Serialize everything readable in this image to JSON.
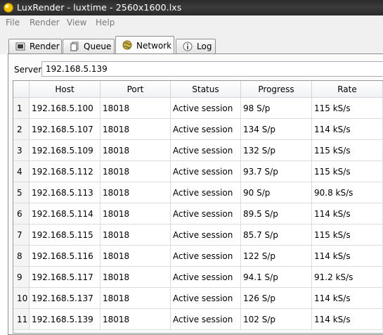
{
  "window": {
    "title": "LuxRender - luxtime - 2560x1600.lxs"
  },
  "menu": [
    "File",
    "Render",
    "View",
    "Help"
  ],
  "tabs": [
    {
      "label": "Render",
      "icon": "render-icon",
      "active": false
    },
    {
      "label": "Queue",
      "icon": "queue-icon",
      "active": false
    },
    {
      "label": "Network",
      "icon": "network-globe-icon",
      "active": true
    },
    {
      "label": "Log",
      "icon": "info-icon",
      "active": false
    }
  ],
  "server": {
    "label": "Server:",
    "value": "192.168.5.139"
  },
  "table": {
    "columns": [
      "Host",
      "Port",
      "Status",
      "Progress",
      "Rate"
    ],
    "rows": [
      {
        "n": "1",
        "host": "192.168.5.100",
        "port": "18018",
        "status": "Active session",
        "progress": "98 S/p",
        "rate": "115 kS/s"
      },
      {
        "n": "2",
        "host": "192.168.5.107",
        "port": "18018",
        "status": "Active session",
        "progress": "134 S/p",
        "rate": "114 kS/s"
      },
      {
        "n": "3",
        "host": "192.168.5.109",
        "port": "18018",
        "status": "Active session",
        "progress": "132 S/p",
        "rate": "115 kS/s"
      },
      {
        "n": "4",
        "host": "192.168.5.112",
        "port": "18018",
        "status": "Active session",
        "progress": "93.7 S/p",
        "rate": "115 kS/s"
      },
      {
        "n": "5",
        "host": "192.168.5.113",
        "port": "18018",
        "status": "Active session",
        "progress": "90 S/p",
        "rate": "90.8 kS/s"
      },
      {
        "n": "6",
        "host": "192.168.5.114",
        "port": "18018",
        "status": "Active session",
        "progress": "89.5 S/p",
        "rate": "114 kS/s"
      },
      {
        "n": "7",
        "host": "192.168.5.115",
        "port": "18018",
        "status": "Active session",
        "progress": "85.7 S/p",
        "rate": "115 kS/s"
      },
      {
        "n": "8",
        "host": "192.168.5.116",
        "port": "18018",
        "status": "Active session",
        "progress": "122 S/p",
        "rate": "114 kS/s"
      },
      {
        "n": "9",
        "host": "192.168.5.117",
        "port": "18018",
        "status": "Active session",
        "progress": "94.1 S/p",
        "rate": "91.2 kS/s"
      },
      {
        "n": "10",
        "host": "192.168.5.137",
        "port": "18018",
        "status": "Active session",
        "progress": "126 S/p",
        "rate": "114 kS/s"
      },
      {
        "n": "11",
        "host": "192.168.5.139",
        "port": "18018",
        "status": "Active session",
        "progress": "102 S/p",
        "rate": "114 kS/s"
      }
    ]
  }
}
